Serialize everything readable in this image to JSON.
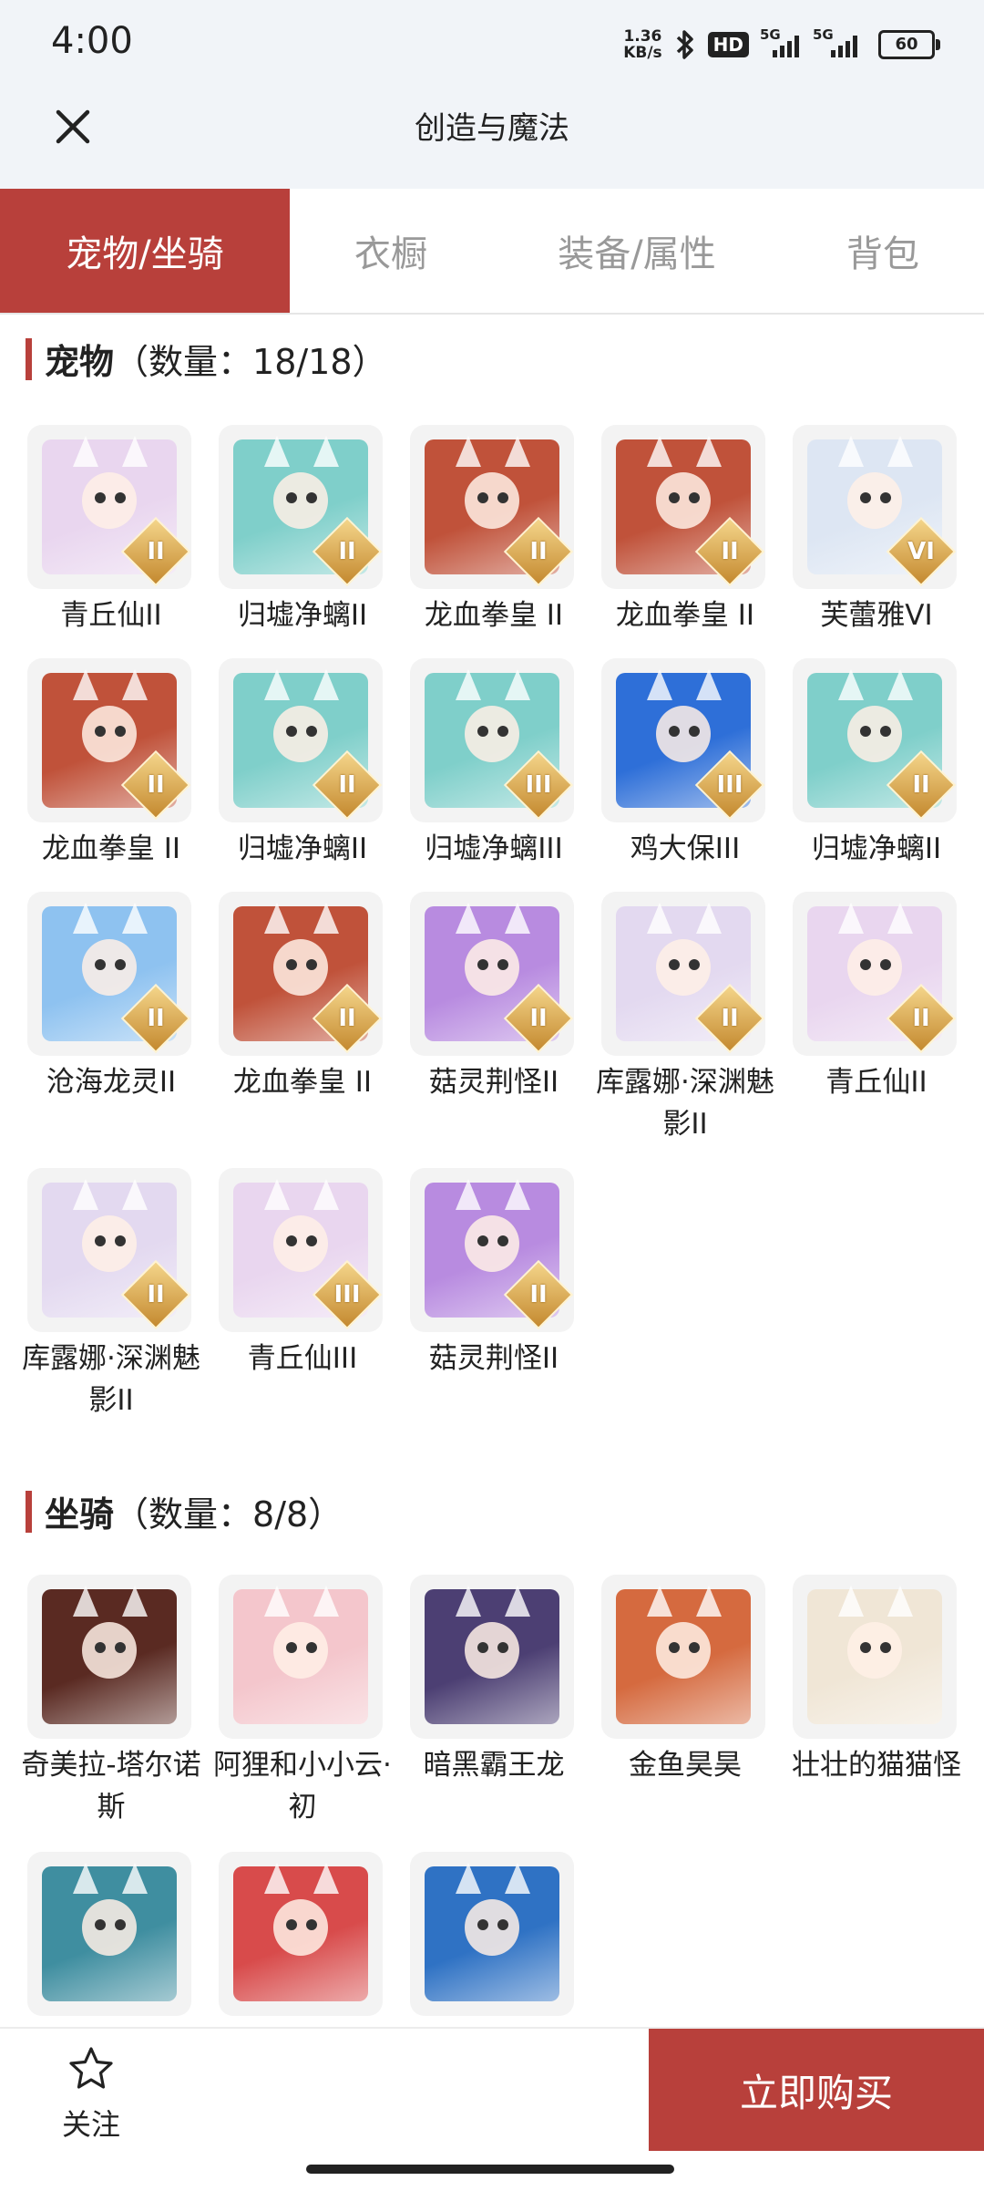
{
  "status_bar": {
    "time": "4:00",
    "net_speed_value": "1.36",
    "net_speed_unit": "KB/s",
    "hd": "HD",
    "sig1": "5G",
    "sig2": "5G",
    "battery": "60",
    "icons": [
      "bluetooth-icon",
      "signal-icon",
      "battery-icon"
    ]
  },
  "header": {
    "title": "创造与魔法",
    "close_icon": "close-icon"
  },
  "tabs": [
    {
      "label": "宠物/坐骑",
      "active": true
    },
    {
      "label": "衣橱",
      "active": false
    },
    {
      "label": "装备/属性",
      "active": false
    },
    {
      "label": "背包",
      "active": false
    }
  ],
  "colors": {
    "accent": "#b8403b",
    "header_bg": "#f1f4f8",
    "thumb_bg": "#f3f3f3",
    "grade_gold": "#d9a54a"
  },
  "pets": {
    "title": "宠物",
    "count": "（数量：18/18）",
    "items": [
      {
        "name": "青丘仙II",
        "grade": "II",
        "color": "#e9d6ef"
      },
      {
        "name": "归墟净螭II",
        "grade": "II",
        "color": "#7fcfca"
      },
      {
        "name": "龙血拳皇 II",
        "grade": "II",
        "color": "#c0523a"
      },
      {
        "name": "龙血拳皇 II",
        "grade": "II",
        "color": "#c0523a"
      },
      {
        "name": "芙蕾雅VI",
        "grade": "VI",
        "color": "#dde6f3"
      },
      {
        "name": "龙血拳皇 II",
        "grade": "II",
        "color": "#c0523a"
      },
      {
        "name": "归墟净螭II",
        "grade": "II",
        "color": "#7fcfca"
      },
      {
        "name": "归墟净螭III",
        "grade": "III",
        "color": "#7fcfca"
      },
      {
        "name": "鸡大保III",
        "grade": "III",
        "color": "#2e6fd8"
      },
      {
        "name": "归墟净螭II",
        "grade": "II",
        "color": "#7fcfca"
      },
      {
        "name": "沧海龙灵II",
        "grade": "II",
        "color": "#8ec2f0"
      },
      {
        "name": "龙血拳皇 II",
        "grade": "II",
        "color": "#c0523a"
      },
      {
        "name": "菇灵荆怪II",
        "grade": "II",
        "color": "#b88be0"
      },
      {
        "name": "库露娜·深渊魅影II",
        "grade": "II",
        "color": "#e3d9f0"
      },
      {
        "name": "青丘仙II",
        "grade": "II",
        "color": "#e9d6ef"
      },
      {
        "name": "库露娜·深渊魅影II",
        "grade": "II",
        "color": "#e3d9f0"
      },
      {
        "name": "青丘仙III",
        "grade": "III",
        "color": "#e9d6ef"
      },
      {
        "name": "菇灵荆怪II",
        "grade": "II",
        "color": "#b88be0"
      }
    ]
  },
  "mounts": {
    "title": "坐骑",
    "count": "（数量：8/8）",
    "items": [
      {
        "name": "奇美拉-塔尔诺斯",
        "color": "#5a2a22"
      },
      {
        "name": "阿狸和小小云·初",
        "color": "#f4c6cc"
      },
      {
        "name": "暗黑霸王龙",
        "color": "#4c3f73"
      },
      {
        "name": "金鱼昊昊",
        "color": "#d56a3f"
      },
      {
        "name": "壮壮的猫猫怪",
        "color": "#f0e6d6"
      },
      {
        "name": "",
        "color": "#3f8ea0"
      },
      {
        "name": "",
        "color": "#d84b4b"
      },
      {
        "name": "",
        "color": "#2f72c4"
      }
    ]
  },
  "bottom": {
    "follow_label": "关注",
    "follow_icon": "star-icon",
    "buy_label": "立即购买"
  }
}
